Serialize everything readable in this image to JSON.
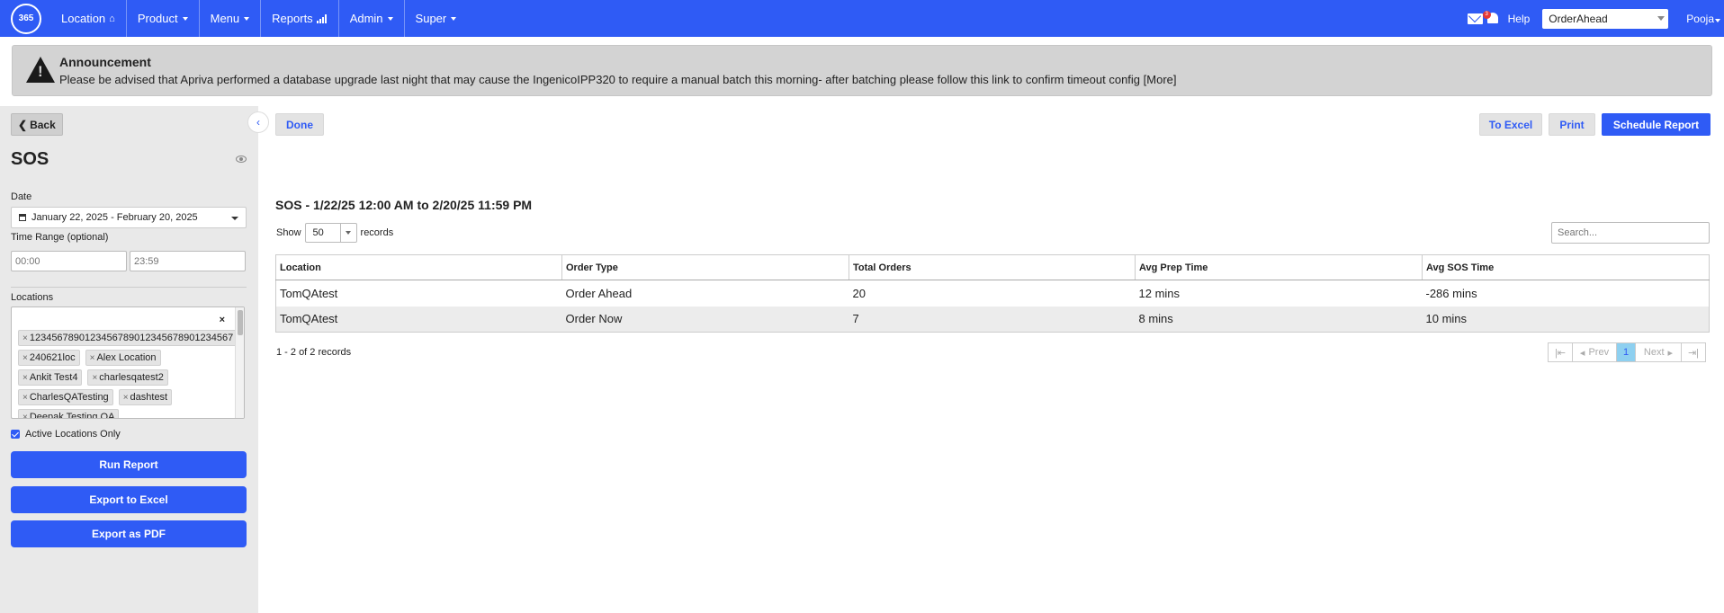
{
  "navbar": {
    "logo_text": "365",
    "items": [
      {
        "label": "Location",
        "icon": "home-icon",
        "caret": false
      },
      {
        "label": "Product",
        "caret": true
      },
      {
        "label": "Menu",
        "caret": true
      },
      {
        "label": "Reports",
        "icon": "bar-chart-icon",
        "caret": false
      },
      {
        "label": "Admin",
        "caret": true
      },
      {
        "label": "Super",
        "caret": true
      }
    ],
    "help_label": "Help",
    "notification_count": "3",
    "location_select_value": "OrderAhead",
    "user_label": "Pooja",
    "brand_color": "#2f5bf5"
  },
  "announcement": {
    "title": "Announcement",
    "text": "Please be advised that Apriva performed a database upgrade last night that may cause the IngenicoIPP320 to require a manual batch this morning- after batching please follow this link to confirm timeout config [More]"
  },
  "sidebar": {
    "back_label": "Back",
    "title": "SOS",
    "date_label": "Date",
    "date_value": "January 22, 2025 - February 20, 2025",
    "time_range_label": "Time Range (optional)",
    "time_start_placeholder": "00:00",
    "time_end_placeholder": "23:59",
    "locations_label": "Locations",
    "locations_clear": "×",
    "locations": [
      "1234567890123456789012345678901234567",
      "240621loc",
      "Alex Location",
      "Ankit Test4",
      "charlesqatest2",
      "CharlesQATesting",
      "dashtest",
      "Deepak Testing QA"
    ],
    "active_only_label": "Active Locations Only",
    "active_only_checked": true,
    "run_report_label": "Run Report",
    "export_excel_label": "Export to Excel",
    "export_pdf_label": "Export as PDF"
  },
  "main": {
    "done_label": "Done",
    "to_excel_label": "To Excel",
    "print_label": "Print",
    "schedule_label": "Schedule Report",
    "report_title": "SOS - 1/22/25 12:00 AM to 2/20/25 11:59 PM",
    "show_label": "Show",
    "show_value": "50",
    "records_label": "records",
    "search_placeholder": "Search...",
    "columns": [
      "Location",
      "Order Type",
      "Total Orders",
      "Avg Prep Time",
      "Avg SOS Time"
    ],
    "rows": [
      [
        "TomQAtest",
        "Order Ahead",
        "20",
        "12 mins",
        "-286 mins"
      ],
      [
        "TomQAtest",
        "Order Now",
        "7",
        "8 mins",
        "10 mins"
      ]
    ],
    "footer_count": "1 - 2 of 2 records",
    "pager": {
      "prev": "Prev",
      "page": "1",
      "next": "Next"
    }
  }
}
